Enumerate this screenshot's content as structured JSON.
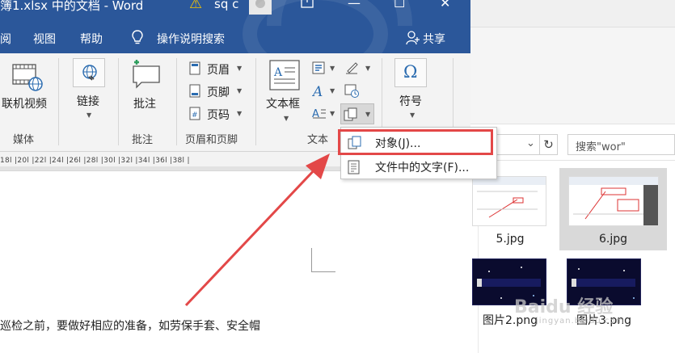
{
  "window": {
    "title": "簿1.xlsx 中的文档 - Word",
    "user": "sq c",
    "warning_icon": "warning-icon",
    "controls": [
      "share-window-icon",
      "minimize-icon",
      "maximize-icon",
      "close-icon"
    ]
  },
  "menu": {
    "items": [
      "阅",
      "视图",
      "帮助"
    ],
    "tell_me": "操作说明搜索",
    "share": "共享"
  },
  "ribbon": {
    "online_video": "联机视频",
    "link": "链接",
    "comment": "批注",
    "header": "页眉",
    "footer": "页脚",
    "page_number": "页码",
    "textbox": "文本框",
    "symbol": "符号",
    "groups": {
      "media": "媒体",
      "comments": "批注",
      "header_footer": "页眉和页脚",
      "text": "文本"
    }
  },
  "ruler": {
    "ticks": "18l  |20l  |22l  |24l  |26l  |28l  |30l  |32l  |34l  |36l  |38l  |"
  },
  "dropdown": {
    "items": [
      {
        "label": "对象(J)...",
        "icon": "object-icon"
      },
      {
        "label": "文件中的文字(F)...",
        "icon": "text-from-file-icon"
      }
    ]
  },
  "document": {
    "text": "巡检之前，要做好相应的准备，如劳保手套、安全帽"
  },
  "explorer": {
    "search_placeholder": "搜索\"wor\"",
    "files": [
      {
        "name": "5.jpg",
        "selected": false
      },
      {
        "name": "6.jpg",
        "selected": true
      },
      {
        "name": "图片2.png",
        "selected": false
      },
      {
        "name": "图片3.png",
        "selected": false
      }
    ]
  },
  "watermark": {
    "text": "Baidu 经验",
    "sub": "jingyan.baidu.com"
  },
  "colors": {
    "word_blue": "#2b579a",
    "highlight_red": "#e34848"
  }
}
